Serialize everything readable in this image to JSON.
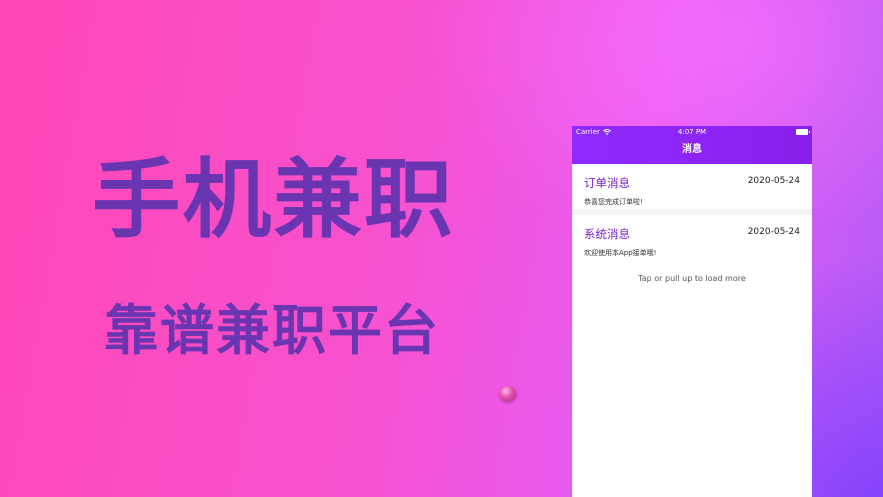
{
  "promo": {
    "headline": "手机兼职",
    "subline": "靠谱兼职平台"
  },
  "phone": {
    "status_bar": {
      "carrier": "Carrier",
      "time": "4:07 PM"
    },
    "nav_title": "消息",
    "messages": [
      {
        "title": "订单消息",
        "date": "2020-05-24",
        "body": "恭喜您完成订单啦!"
      },
      {
        "title": "系统消息",
        "date": "2020-05-24",
        "body": "欢迎使用本App接单哦!"
      }
    ],
    "load_more": "Tap or pull up to load more"
  },
  "colors": {
    "nav_bar": "#8f2bff",
    "title_text": "#7a22c9",
    "headline_text": "#6a35b0"
  }
}
